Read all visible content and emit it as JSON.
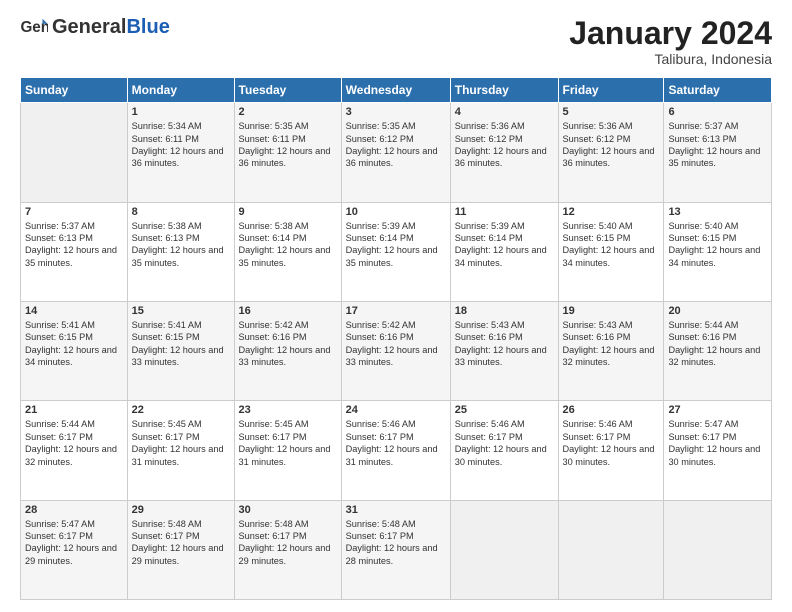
{
  "header": {
    "logo_general": "General",
    "logo_blue": "Blue",
    "month_year": "January 2024",
    "location": "Talibura, Indonesia"
  },
  "weekdays": [
    "Sunday",
    "Monday",
    "Tuesday",
    "Wednesday",
    "Thursday",
    "Friday",
    "Saturday"
  ],
  "weeks": [
    [
      {
        "day": "",
        "sunrise": "",
        "sunset": "",
        "daylight": ""
      },
      {
        "day": "1",
        "sunrise": "Sunrise: 5:34 AM",
        "sunset": "Sunset: 6:11 PM",
        "daylight": "Daylight: 12 hours and 36 minutes."
      },
      {
        "day": "2",
        "sunrise": "Sunrise: 5:35 AM",
        "sunset": "Sunset: 6:11 PM",
        "daylight": "Daylight: 12 hours and 36 minutes."
      },
      {
        "day": "3",
        "sunrise": "Sunrise: 5:35 AM",
        "sunset": "Sunset: 6:12 PM",
        "daylight": "Daylight: 12 hours and 36 minutes."
      },
      {
        "day": "4",
        "sunrise": "Sunrise: 5:36 AM",
        "sunset": "Sunset: 6:12 PM",
        "daylight": "Daylight: 12 hours and 36 minutes."
      },
      {
        "day": "5",
        "sunrise": "Sunrise: 5:36 AM",
        "sunset": "Sunset: 6:12 PM",
        "daylight": "Daylight: 12 hours and 36 minutes."
      },
      {
        "day": "6",
        "sunrise": "Sunrise: 5:37 AM",
        "sunset": "Sunset: 6:13 PM",
        "daylight": "Daylight: 12 hours and 35 minutes."
      }
    ],
    [
      {
        "day": "7",
        "sunrise": "Sunrise: 5:37 AM",
        "sunset": "Sunset: 6:13 PM",
        "daylight": "Daylight: 12 hours and 35 minutes."
      },
      {
        "day": "8",
        "sunrise": "Sunrise: 5:38 AM",
        "sunset": "Sunset: 6:13 PM",
        "daylight": "Daylight: 12 hours and 35 minutes."
      },
      {
        "day": "9",
        "sunrise": "Sunrise: 5:38 AM",
        "sunset": "Sunset: 6:14 PM",
        "daylight": "Daylight: 12 hours and 35 minutes."
      },
      {
        "day": "10",
        "sunrise": "Sunrise: 5:39 AM",
        "sunset": "Sunset: 6:14 PM",
        "daylight": "Daylight: 12 hours and 35 minutes."
      },
      {
        "day": "11",
        "sunrise": "Sunrise: 5:39 AM",
        "sunset": "Sunset: 6:14 PM",
        "daylight": "Daylight: 12 hours and 34 minutes."
      },
      {
        "day": "12",
        "sunrise": "Sunrise: 5:40 AM",
        "sunset": "Sunset: 6:15 PM",
        "daylight": "Daylight: 12 hours and 34 minutes."
      },
      {
        "day": "13",
        "sunrise": "Sunrise: 5:40 AM",
        "sunset": "Sunset: 6:15 PM",
        "daylight": "Daylight: 12 hours and 34 minutes."
      }
    ],
    [
      {
        "day": "14",
        "sunrise": "Sunrise: 5:41 AM",
        "sunset": "Sunset: 6:15 PM",
        "daylight": "Daylight: 12 hours and 34 minutes."
      },
      {
        "day": "15",
        "sunrise": "Sunrise: 5:41 AM",
        "sunset": "Sunset: 6:15 PM",
        "daylight": "Daylight: 12 hours and 33 minutes."
      },
      {
        "day": "16",
        "sunrise": "Sunrise: 5:42 AM",
        "sunset": "Sunset: 6:16 PM",
        "daylight": "Daylight: 12 hours and 33 minutes."
      },
      {
        "day": "17",
        "sunrise": "Sunrise: 5:42 AM",
        "sunset": "Sunset: 6:16 PM",
        "daylight": "Daylight: 12 hours and 33 minutes."
      },
      {
        "day": "18",
        "sunrise": "Sunrise: 5:43 AM",
        "sunset": "Sunset: 6:16 PM",
        "daylight": "Daylight: 12 hours and 33 minutes."
      },
      {
        "day": "19",
        "sunrise": "Sunrise: 5:43 AM",
        "sunset": "Sunset: 6:16 PM",
        "daylight": "Daylight: 12 hours and 32 minutes."
      },
      {
        "day": "20",
        "sunrise": "Sunrise: 5:44 AM",
        "sunset": "Sunset: 6:16 PM",
        "daylight": "Daylight: 12 hours and 32 minutes."
      }
    ],
    [
      {
        "day": "21",
        "sunrise": "Sunrise: 5:44 AM",
        "sunset": "Sunset: 6:17 PM",
        "daylight": "Daylight: 12 hours and 32 minutes."
      },
      {
        "day": "22",
        "sunrise": "Sunrise: 5:45 AM",
        "sunset": "Sunset: 6:17 PM",
        "daylight": "Daylight: 12 hours and 31 minutes."
      },
      {
        "day": "23",
        "sunrise": "Sunrise: 5:45 AM",
        "sunset": "Sunset: 6:17 PM",
        "daylight": "Daylight: 12 hours and 31 minutes."
      },
      {
        "day": "24",
        "sunrise": "Sunrise: 5:46 AM",
        "sunset": "Sunset: 6:17 PM",
        "daylight": "Daylight: 12 hours and 31 minutes."
      },
      {
        "day": "25",
        "sunrise": "Sunrise: 5:46 AM",
        "sunset": "Sunset: 6:17 PM",
        "daylight": "Daylight: 12 hours and 30 minutes."
      },
      {
        "day": "26",
        "sunrise": "Sunrise: 5:46 AM",
        "sunset": "Sunset: 6:17 PM",
        "daylight": "Daylight: 12 hours and 30 minutes."
      },
      {
        "day": "27",
        "sunrise": "Sunrise: 5:47 AM",
        "sunset": "Sunset: 6:17 PM",
        "daylight": "Daylight: 12 hours and 30 minutes."
      }
    ],
    [
      {
        "day": "28",
        "sunrise": "Sunrise: 5:47 AM",
        "sunset": "Sunset: 6:17 PM",
        "daylight": "Daylight: 12 hours and 29 minutes."
      },
      {
        "day": "29",
        "sunrise": "Sunrise: 5:48 AM",
        "sunset": "Sunset: 6:17 PM",
        "daylight": "Daylight: 12 hours and 29 minutes."
      },
      {
        "day": "30",
        "sunrise": "Sunrise: 5:48 AM",
        "sunset": "Sunset: 6:17 PM",
        "daylight": "Daylight: 12 hours and 29 minutes."
      },
      {
        "day": "31",
        "sunrise": "Sunrise: 5:48 AM",
        "sunset": "Sunset: 6:17 PM",
        "daylight": "Daylight: 12 hours and 28 minutes."
      },
      {
        "day": "",
        "sunrise": "",
        "sunset": "",
        "daylight": ""
      },
      {
        "day": "",
        "sunrise": "",
        "sunset": "",
        "daylight": ""
      },
      {
        "day": "",
        "sunrise": "",
        "sunset": "",
        "daylight": ""
      }
    ]
  ]
}
